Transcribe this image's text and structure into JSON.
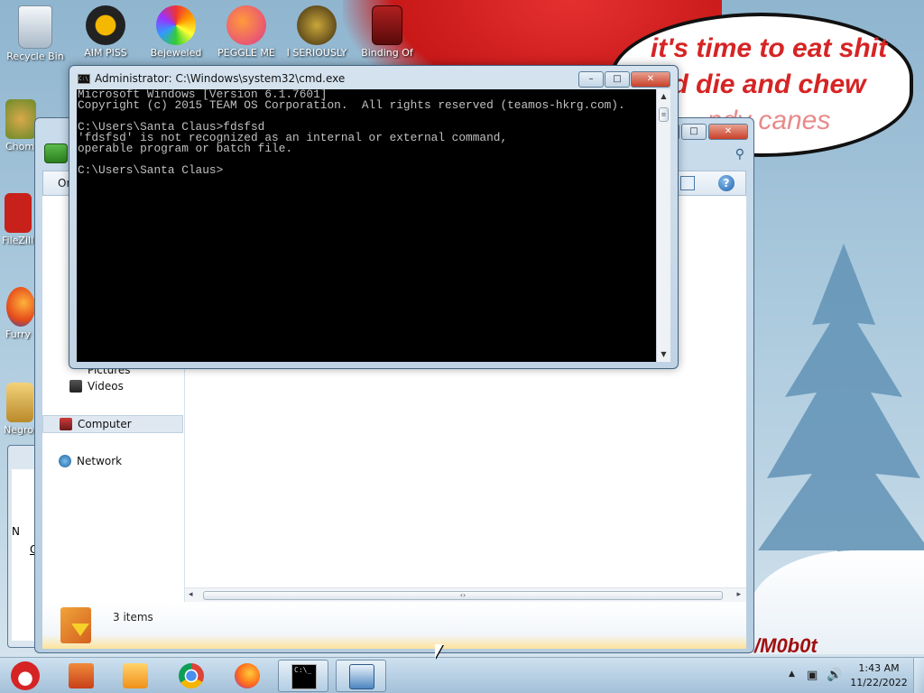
{
  "desktop": {
    "bubble_lines": [
      "it's time to eat shit",
      "d die and chew",
      "ndy canes"
    ],
    "watermark": "/M0b0t",
    "icons": [
      {
        "label": "Recycle Bin",
        "icon": "recycle-bin-icon"
      },
      {
        "label": "AIM PISS",
        "icon": "aim-icon"
      },
      {
        "label": "Bejeweled",
        "icon": "bejeweled-icon"
      },
      {
        "label": "PEGGLE ME",
        "icon": "peggle-icon"
      },
      {
        "label": "I SERIOUSLY",
        "icon": "seriously-icon"
      },
      {
        "label": "Binding Of",
        "icon": "binding-of-isaac-icon"
      },
      {
        "label": "Chom",
        "icon": "chom-icon"
      },
      {
        "label": "FileZill",
        "icon": "filezilla-icon"
      },
      {
        "label": "Furry",
        "icon": "firefox-furry-icon"
      },
      {
        "label": "Negro",
        "icon": "house-icon"
      }
    ]
  },
  "explorer": {
    "toolbar_organize": "Or",
    "nav_partial_pictures": "Pictures",
    "nav_videos": "Videos",
    "nav_computer": "Computer",
    "nav_network": "Network",
    "status_items": "3 items",
    "partial_left_labels": [
      "N",
      "O"
    ]
  },
  "cmd": {
    "title": "Administrator: C:\\Windows\\system32\\cmd.exe",
    "lines": [
      "Microsoft Windows [Version 6.1.7601]",
      "Copyright (c) 2015 TEAM OS Corporation.  All rights reserved (teamos-hkrg.com).",
      "",
      "C:\\Users\\Santa Claus>fdsfsd",
      "'fdsfsd' is not recognized as an internal or external command,",
      "operable program or batch file.",
      "",
      "C:\\Users\\Santa Claus>"
    ]
  },
  "taskbar": {
    "buttons": [
      "start-button",
      "file-explorer",
      "media-player",
      "chrome",
      "firefox",
      "command-prompt",
      "window-app"
    ],
    "time": "1:43 AM",
    "date": "11/22/2022"
  },
  "colors": {
    "cmd_bg": "#000000",
    "cmd_fg": "#c0c0c0",
    "bubble_text": "#d62424"
  }
}
